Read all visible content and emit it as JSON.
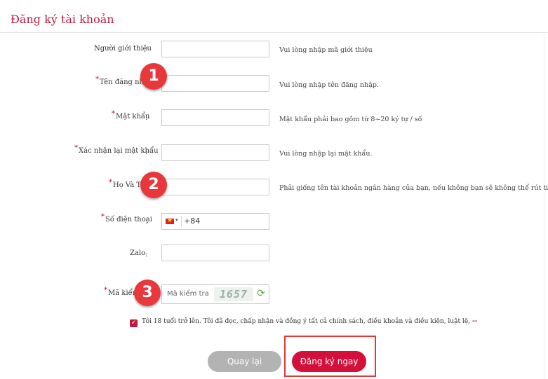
{
  "page": {
    "title": "Đăng ký tài khoản"
  },
  "fields": [
    {
      "key": "referrer",
      "label": "Người giới thiệu",
      "required": false,
      "value": "",
      "hint": "Vui lòng nhập mã giới thiệu"
    },
    {
      "key": "username",
      "label": "Tên đăng nhập",
      "required": true,
      "value": "",
      "hint": "Vui lòng nhập tên đăng nhập."
    },
    {
      "key": "password",
      "label": "Mật khẩu",
      "required": true,
      "value": "",
      "hint": "Mật khẩu phải bao gồm từ 8~20 ký tự / số"
    },
    {
      "key": "confirm_password",
      "label": "Xác nhận lại mật khẩu",
      "required": true,
      "value": "",
      "hint": "Vui lòng nhập lại mật khẩu."
    },
    {
      "key": "full_name",
      "label": "Họ Và Tên",
      "required": true,
      "value": "",
      "hint": "Phải giống tên tài khoản ngân hàng của bạn, nếu không bạn sẽ không thể rút tiền"
    },
    {
      "key": "phone",
      "label": "Số điện thoại",
      "required": true,
      "value": "+84",
      "hint": ""
    },
    {
      "key": "zalo",
      "label": "Zalo",
      "required": false,
      "value": "",
      "hint": ""
    },
    {
      "key": "captcha",
      "label": "Mã kiểm tra",
      "required": true,
      "value": "",
      "placeholder": "Mã kiểm tra",
      "hint": ""
    }
  ],
  "separator": ":",
  "required_mark": "*",
  "phone": {
    "country_icon": "vietnam-flag-icon",
    "caret": "▾",
    "prefix": "+84"
  },
  "captcha": {
    "code": "1657",
    "refresh_icon": "refresh-icon",
    "refresh_glyph": "⟳"
  },
  "terms": {
    "checked": true,
    "check_glyph": "✓",
    "text": "Tôi 18 tuổi trở lên. Tôi đã đọc, chấp nhận và đồng ý tất cả chính sách, điều khoản và điều kiện, luật lệ,",
    "arrow": "↔"
  },
  "buttons": {
    "back": "Quay lại",
    "register": "Đăng ký ngay"
  },
  "annotations": {
    "badge_1": "1",
    "badge_2": "2",
    "badge_3": "3"
  },
  "colors": {
    "title": "#c0183c",
    "register_button": "#d40f3a",
    "back_button": "#b3b3b3",
    "badge": "#e8383b",
    "highlight": "#e33838"
  }
}
